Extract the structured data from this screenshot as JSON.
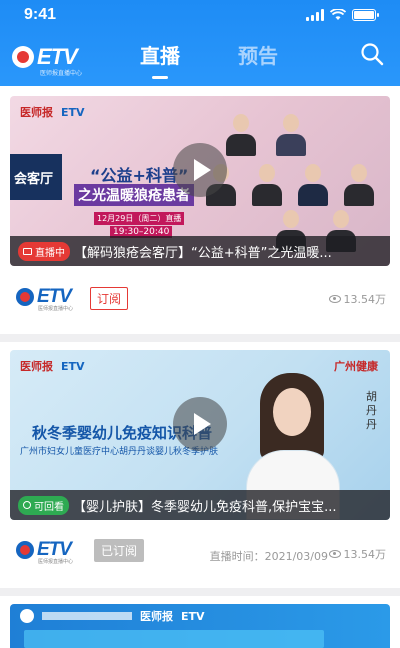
{
  "status_bar": {
    "time": "9:41"
  },
  "header": {
    "logo_word": "ETV",
    "logo_tag": "医师报直播中心",
    "tabs": [
      {
        "label": "直播",
        "active": true
      },
      {
        "label": "预告",
        "active": false
      }
    ],
    "search_icon": "search-icon"
  },
  "cards": [
    {
      "badge": "直播中",
      "badge_type": "live",
      "caption": "【解码狼疮会客厅】“公益+科普”之光温暖...",
      "poster": {
        "brand_left": "医师报",
        "brand_mid": "ETV",
        "line1": "“公益+科普”",
        "line2": "之光温暖狼疮患者",
        "side": "会客厅",
        "date": "12月29日（周二）直播",
        "time": "19:30–20:40"
      },
      "subscribe_label": "订阅",
      "subscribed": false,
      "views": "13.54万",
      "airtime": ""
    },
    {
      "badge": "可回看",
      "badge_type": "replay",
      "caption": "【婴儿护肤】冬季婴幼儿免疫科普,保护宝宝...",
      "poster": {
        "brand_left": "医师报",
        "brand_mid": "ETV",
        "brand_right": "广州健康",
        "line1": "秋冬季婴幼儿免疫知识科普",
        "line2": "广州市妇女儿童医疗中心胡丹丹谈婴儿秋冬季护肤",
        "side": "胡丹丹"
      },
      "subscribe_label": "已订阅",
      "subscribed": true,
      "views": "13.54万",
      "airtime": "直播时间：2021/03/09"
    }
  ],
  "colors": {
    "header_blue": "#2a97fb",
    "live_red": "#e53935",
    "replay_green": "#2eaa52",
    "brand_blue": "#1565c0"
  }
}
